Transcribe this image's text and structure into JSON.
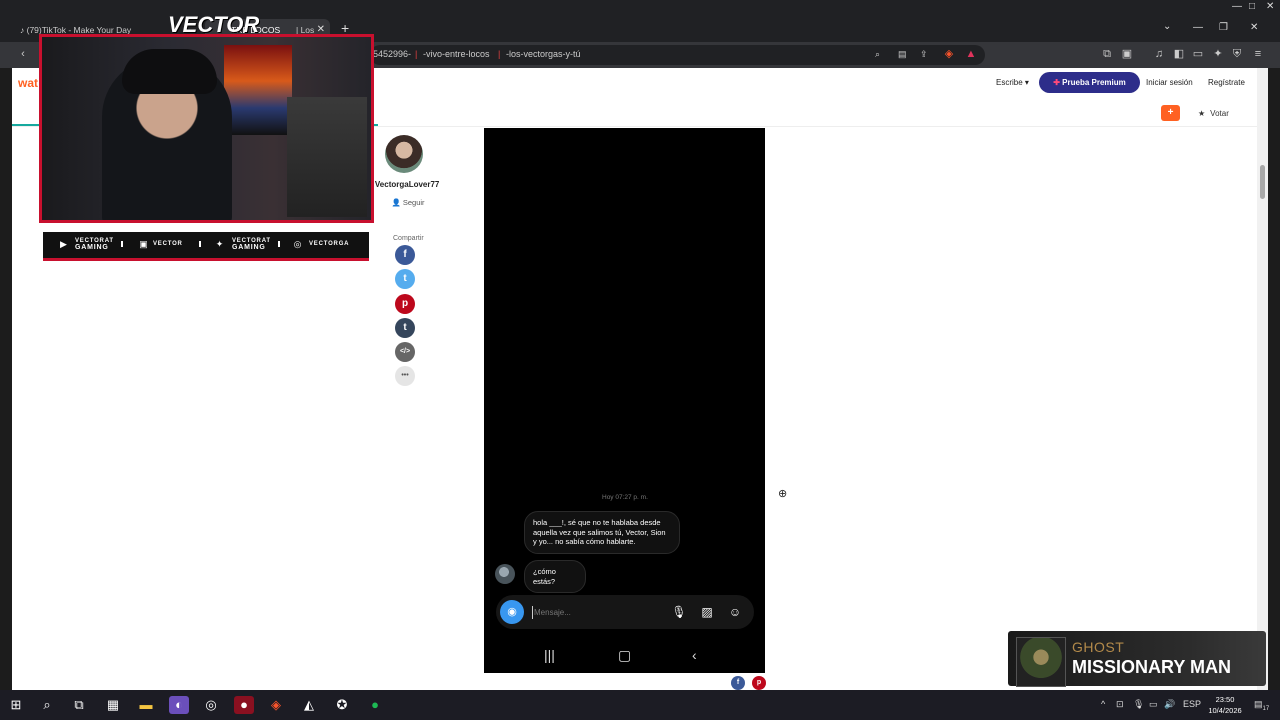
{
  "browser": {
    "tabs": [
      {
        "label": "(79)TikTok - Make Your Day"
      },
      {
        "label": "TRE LOCOS"
      },
      {
        "label": "| Los"
      }
    ],
    "url_segments": [
      "5452996-",
      "-vivo-entre-locos",
      "-los-vectorgas-y-tú"
    ]
  },
  "header": {
    "logo": "wat",
    "write": "Escribe",
    "premium": "Prueba Premium",
    "login": "Iniciar sesión",
    "register": "Regístrate",
    "add": "+",
    "vote": "Votar"
  },
  "author": {
    "prefix": "r",
    "name": "VectorgaLover77",
    "follow": "Seguir"
  },
  "share": {
    "label": "Compartir",
    "items": [
      {
        "icon": "facebook-icon",
        "glyph": "f",
        "color": "#3b5998"
      },
      {
        "icon": "twitter-icon",
        "glyph": "t",
        "color": "#55acee"
      },
      {
        "icon": "pinterest-icon",
        "glyph": "p",
        "color": "#bd081c"
      },
      {
        "icon": "tumblr-icon",
        "glyph": "t",
        "color": "#35465c"
      },
      {
        "icon": "embed-icon",
        "glyph": "</>",
        "color": "#666666"
      },
      {
        "icon": "more-icon",
        "glyph": "•••",
        "color": "#e5e5e5"
      }
    ]
  },
  "chat": {
    "timestamp": "Hoy 07:27 p. m.",
    "messages": [
      "hola ___!, sé que no te hablaba desde aquella vez que salimos tú, Vector, Sion y yo... no sabía cómo hablarte.",
      "¿cómo estás?"
    ],
    "placeholder": "Mensaje..."
  },
  "overlay": {
    "logo": "VECTOR",
    "socials": [
      {
        "icon": "youtube-icon",
        "line1": "VECTORAT",
        "line2": "GAMING"
      },
      {
        "icon": "twitch-icon",
        "line1": "VECTOR",
        "line2": ""
      },
      {
        "icon": "twitter-icon",
        "line1": "VECTORAT",
        "line2": "GAMING"
      },
      {
        "icon": "instagram-icon",
        "line1": "VECTORGA",
        "line2": ""
      }
    ],
    "now_playing": {
      "artist": "GHOST",
      "title": "MISSIONARY MAN"
    }
  },
  "taskbar": {
    "lang": "ESP",
    "time": "23:50",
    "date": "10/4/2026",
    "notifications": "17"
  },
  "colors": {
    "accent_red": "#c8102e",
    "premium": "#2d2d8a",
    "brand_orange": "#ff6122",
    "teal": "#16a99e"
  }
}
